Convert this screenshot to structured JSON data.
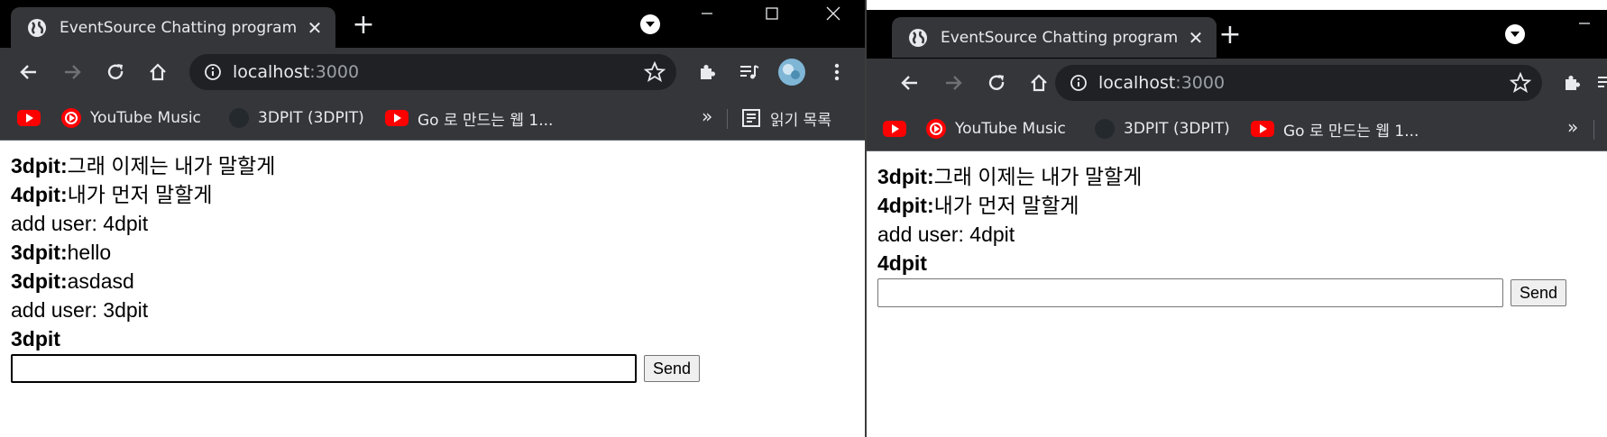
{
  "left": {
    "tab_title": "EventSource Chatting program",
    "url_host": "localhost",
    "url_port": ":3000",
    "bookmarks": [
      {
        "label": "",
        "icon": "youtube-icon"
      },
      {
        "label": "YouTube Music",
        "icon": "youtube-music-icon"
      },
      {
        "label": "3DPIT (3DPIT)",
        "icon": "github-icon"
      },
      {
        "label": "Go 로 만드는 웹 1...",
        "icon": "youtube-icon"
      }
    ],
    "more_label": "»",
    "reading_list_label": "읽기 목록",
    "messages": [
      {
        "user": "3dpit:",
        "text": "그래 이제는 내가 말할게"
      },
      {
        "user": "4dpit:",
        "text": "내가 먼저 말할게"
      },
      {
        "user": "",
        "text": "add user: 4dpit"
      },
      {
        "user": "3dpit:",
        "text": "hello"
      },
      {
        "user": "3dpit:",
        "text": "asdasd"
      },
      {
        "user": "",
        "text": "add user: 3dpit"
      }
    ],
    "me": "3dpit",
    "input_value": "",
    "send_label": "Send"
  },
  "right": {
    "tab_title": "EventSource Chatting program",
    "url_host": "localhost",
    "url_port": ":3000",
    "bookmarks": [
      {
        "label": "",
        "icon": "youtube-icon"
      },
      {
        "label": "YouTube Music",
        "icon": "youtube-music-icon"
      },
      {
        "label": "3DPIT (3DPIT)",
        "icon": "github-icon"
      },
      {
        "label": "Go 로 만드는 웹 1...",
        "icon": "youtube-icon"
      }
    ],
    "more_label": "»",
    "messages": [
      {
        "user": "3dpit:",
        "text": "그래 이제는 내가 말할게"
      },
      {
        "user": "4dpit:",
        "text": "내가 먼저 말할게"
      },
      {
        "user": "",
        "text": "add user: 4dpit"
      }
    ],
    "me": "4dpit",
    "input_value": "",
    "send_label": "Send"
  },
  "colors": {
    "titlebar": "#000000",
    "tab_active": "#35363a",
    "toolbar": "#35363a",
    "omnibox": "#202124",
    "text_light": "#e8eaed"
  }
}
